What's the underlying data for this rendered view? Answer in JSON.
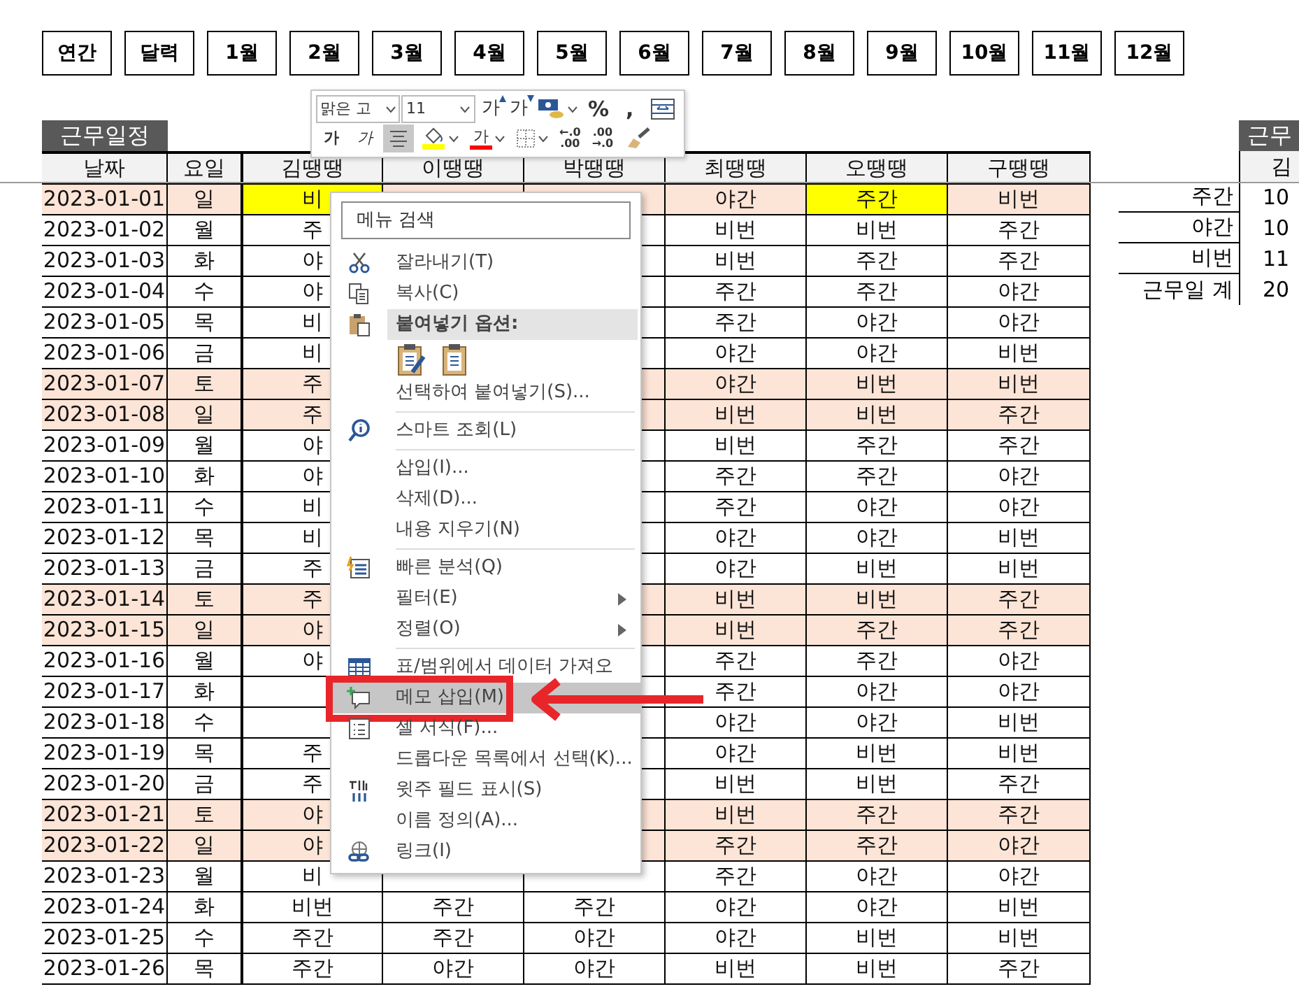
{
  "nav_buttons": [
    "연간",
    "달력",
    "1월",
    "2월",
    "3월",
    "4월",
    "5월",
    "6월",
    "7월",
    "8월",
    "9월",
    "10월",
    "11월",
    "12월"
  ],
  "schedule": {
    "title": "근무일정",
    "columns": [
      "날짜",
      "요일",
      "김땡땡",
      "이땡땡",
      "박땡땡",
      "최땡땡",
      "오땡땡",
      "구땡땡"
    ],
    "rows": [
      {
        "weekend": true,
        "cells": [
          {
            "text": "2023-01-01",
            "highlighted": false
          },
          {
            "text": "일",
            "highlighted": false
          },
          {
            "text": "비",
            "highlighted": true
          },
          null,
          null,
          {
            "text": "야간",
            "highlighted": false
          },
          {
            "text": "주간",
            "highlighted": true
          },
          {
            "text": "비번",
            "highlighted": false
          }
        ]
      },
      {
        "weekend": false,
        "cells": [
          {
            "text": "2023-01-02",
            "highlighted": false
          },
          {
            "text": "월",
            "highlighted": false
          },
          {
            "text": "주",
            "highlighted": false
          },
          null,
          null,
          {
            "text": "비번",
            "highlighted": false
          },
          {
            "text": "비번",
            "highlighted": false
          },
          {
            "text": "주간",
            "highlighted": false
          }
        ]
      },
      {
        "weekend": false,
        "cells": [
          {
            "text": "2023-01-03",
            "highlighted": false
          },
          {
            "text": "화",
            "highlighted": false
          },
          {
            "text": "야",
            "highlighted": false
          },
          null,
          null,
          {
            "text": "비번",
            "highlighted": false
          },
          {
            "text": "주간",
            "highlighted": false
          },
          {
            "text": "주간",
            "highlighted": false
          }
        ]
      },
      {
        "weekend": false,
        "cells": [
          {
            "text": "2023-01-04",
            "highlighted": false
          },
          {
            "text": "수",
            "highlighted": false
          },
          {
            "text": "야",
            "highlighted": false
          },
          null,
          null,
          {
            "text": "주간",
            "highlighted": false
          },
          {
            "text": "주간",
            "highlighted": false
          },
          {
            "text": "야간",
            "highlighted": false
          }
        ]
      },
      {
        "weekend": false,
        "cells": [
          {
            "text": "2023-01-05",
            "highlighted": false
          },
          {
            "text": "목",
            "highlighted": false
          },
          {
            "text": "비",
            "highlighted": false
          },
          null,
          null,
          {
            "text": "주간",
            "highlighted": false
          },
          {
            "text": "야간",
            "highlighted": false
          },
          {
            "text": "야간",
            "highlighted": false
          }
        ]
      },
      {
        "weekend": false,
        "cells": [
          {
            "text": "2023-01-06",
            "highlighted": false
          },
          {
            "text": "금",
            "highlighted": false
          },
          {
            "text": "비",
            "highlighted": false
          },
          null,
          null,
          {
            "text": "야간",
            "highlighted": false
          },
          {
            "text": "야간",
            "highlighted": false
          },
          {
            "text": "비번",
            "highlighted": false
          }
        ]
      },
      {
        "weekend": true,
        "cells": [
          {
            "text": "2023-01-07",
            "highlighted": false
          },
          {
            "text": "토",
            "highlighted": false
          },
          {
            "text": "주",
            "highlighted": false
          },
          null,
          null,
          {
            "text": "야간",
            "highlighted": false
          },
          {
            "text": "비번",
            "highlighted": false
          },
          {
            "text": "비번",
            "highlighted": false
          }
        ]
      },
      {
        "weekend": true,
        "cells": [
          {
            "text": "2023-01-08",
            "highlighted": false
          },
          {
            "text": "일",
            "highlighted": false
          },
          {
            "text": "주",
            "highlighted": false
          },
          null,
          null,
          {
            "text": "비번",
            "highlighted": false
          },
          {
            "text": "비번",
            "highlighted": false
          },
          {
            "text": "주간",
            "highlighted": false
          }
        ]
      },
      {
        "weekend": false,
        "cells": [
          {
            "text": "2023-01-09",
            "highlighted": false
          },
          {
            "text": "월",
            "highlighted": false
          },
          {
            "text": "야",
            "highlighted": false
          },
          null,
          null,
          {
            "text": "비번",
            "highlighted": false
          },
          {
            "text": "주간",
            "highlighted": false
          },
          {
            "text": "주간",
            "highlighted": false
          }
        ]
      },
      {
        "weekend": false,
        "cells": [
          {
            "text": "2023-01-10",
            "highlighted": false
          },
          {
            "text": "화",
            "highlighted": false
          },
          {
            "text": "야",
            "highlighted": false
          },
          null,
          null,
          {
            "text": "주간",
            "highlighted": false
          },
          {
            "text": "주간",
            "highlighted": false
          },
          {
            "text": "야간",
            "highlighted": false
          }
        ]
      },
      {
        "weekend": false,
        "cells": [
          {
            "text": "2023-01-11",
            "highlighted": false
          },
          {
            "text": "수",
            "highlighted": false
          },
          {
            "text": "비",
            "highlighted": false
          },
          null,
          null,
          {
            "text": "주간",
            "highlighted": false
          },
          {
            "text": "야간",
            "highlighted": false
          },
          {
            "text": "야간",
            "highlighted": false
          }
        ]
      },
      {
        "weekend": false,
        "cells": [
          {
            "text": "2023-01-12",
            "highlighted": false
          },
          {
            "text": "목",
            "highlighted": false
          },
          {
            "text": "비",
            "highlighted": false
          },
          null,
          null,
          {
            "text": "야간",
            "highlighted": false
          },
          {
            "text": "야간",
            "highlighted": false
          },
          {
            "text": "비번",
            "highlighted": false
          }
        ]
      },
      {
        "weekend": false,
        "cells": [
          {
            "text": "2023-01-13",
            "highlighted": false
          },
          {
            "text": "금",
            "highlighted": false
          },
          {
            "text": "주",
            "highlighted": false
          },
          null,
          null,
          {
            "text": "야간",
            "highlighted": false
          },
          {
            "text": "비번",
            "highlighted": false
          },
          {
            "text": "비번",
            "highlighted": false
          }
        ]
      },
      {
        "weekend": true,
        "cells": [
          {
            "text": "2023-01-14",
            "highlighted": false
          },
          {
            "text": "토",
            "highlighted": false
          },
          {
            "text": "주",
            "highlighted": false
          },
          null,
          null,
          {
            "text": "비번",
            "highlighted": false
          },
          {
            "text": "비번",
            "highlighted": false
          },
          {
            "text": "주간",
            "highlighted": false
          }
        ]
      },
      {
        "weekend": true,
        "cells": [
          {
            "text": "2023-01-15",
            "highlighted": false
          },
          {
            "text": "일",
            "highlighted": false
          },
          {
            "text": "야",
            "highlighted": false
          },
          null,
          null,
          {
            "text": "비번",
            "highlighted": false
          },
          {
            "text": "주간",
            "highlighted": false
          },
          {
            "text": "주간",
            "highlighted": false
          }
        ]
      },
      {
        "weekend": false,
        "cells": [
          {
            "text": "2023-01-16",
            "highlighted": false
          },
          {
            "text": "월",
            "highlighted": false
          },
          {
            "text": "야",
            "highlighted": false
          },
          null,
          null,
          {
            "text": "주간",
            "highlighted": false
          },
          {
            "text": "주간",
            "highlighted": false
          },
          {
            "text": "야간",
            "highlighted": false
          }
        ]
      },
      {
        "weekend": false,
        "cells": [
          {
            "text": "2023-01-17",
            "highlighted": false
          },
          {
            "text": "화",
            "highlighted": false
          },
          null,
          null,
          null,
          {
            "text": "주간",
            "highlighted": false
          },
          {
            "text": "야간",
            "highlighted": false
          },
          {
            "text": "야간",
            "highlighted": false
          }
        ]
      },
      {
        "weekend": false,
        "cells": [
          {
            "text": "2023-01-18",
            "highlighted": false
          },
          {
            "text": "수",
            "highlighted": false
          },
          null,
          null,
          null,
          {
            "text": "야간",
            "highlighted": false
          },
          {
            "text": "야간",
            "highlighted": false
          },
          {
            "text": "비번",
            "highlighted": false
          }
        ]
      },
      {
        "weekend": false,
        "cells": [
          {
            "text": "2023-01-19",
            "highlighted": false
          },
          {
            "text": "목",
            "highlighted": false
          },
          {
            "text": "주",
            "highlighted": false
          },
          null,
          null,
          {
            "text": "야간",
            "highlighted": false
          },
          {
            "text": "비번",
            "highlighted": false
          },
          {
            "text": "비번",
            "highlighted": false
          }
        ]
      },
      {
        "weekend": false,
        "cells": [
          {
            "text": "2023-01-20",
            "highlighted": false
          },
          {
            "text": "금",
            "highlighted": false
          },
          {
            "text": "주",
            "highlighted": false
          },
          null,
          null,
          {
            "text": "비번",
            "highlighted": false
          },
          {
            "text": "비번",
            "highlighted": false
          },
          {
            "text": "주간",
            "highlighted": false
          }
        ]
      },
      {
        "weekend": true,
        "cells": [
          {
            "text": "2023-01-21",
            "highlighted": false
          },
          {
            "text": "토",
            "highlighted": false
          },
          {
            "text": "야",
            "highlighted": false
          },
          null,
          null,
          {
            "text": "비번",
            "highlighted": false
          },
          {
            "text": "주간",
            "highlighted": false
          },
          {
            "text": "주간",
            "highlighted": false
          }
        ]
      },
      {
        "weekend": true,
        "cells": [
          {
            "text": "2023-01-22",
            "highlighted": false
          },
          {
            "text": "일",
            "highlighted": false
          },
          {
            "text": "야",
            "highlighted": false
          },
          null,
          null,
          {
            "text": "주간",
            "highlighted": false
          },
          {
            "text": "주간",
            "highlighted": false
          },
          {
            "text": "야간",
            "highlighted": false
          }
        ]
      },
      {
        "weekend": false,
        "cells": [
          {
            "text": "2023-01-23",
            "highlighted": false
          },
          {
            "text": "월",
            "highlighted": false
          },
          {
            "text": "비",
            "highlighted": false
          },
          null,
          null,
          {
            "text": "주간",
            "highlighted": false
          },
          {
            "text": "야간",
            "highlighted": false
          },
          {
            "text": "야간",
            "highlighted": false
          }
        ]
      },
      {
        "weekend": false,
        "cells": [
          {
            "text": "2023-01-24",
            "highlighted": false
          },
          {
            "text": "화",
            "highlighted": false
          },
          {
            "text": "비번",
            "highlighted": false
          },
          {
            "text": "주간",
            "highlighted": false
          },
          {
            "text": "주간",
            "highlighted": false
          },
          {
            "text": "야간",
            "highlighted": false
          },
          {
            "text": "야간",
            "highlighted": false
          },
          {
            "text": "비번",
            "highlighted": false
          }
        ]
      },
      {
        "weekend": false,
        "cells": [
          {
            "text": "2023-01-25",
            "highlighted": false
          },
          {
            "text": "수",
            "highlighted": false
          },
          {
            "text": "주간",
            "highlighted": false
          },
          {
            "text": "주간",
            "highlighted": false
          },
          {
            "text": "야간",
            "highlighted": false
          },
          {
            "text": "야간",
            "highlighted": false
          },
          {
            "text": "비번",
            "highlighted": false
          },
          {
            "text": "비번",
            "highlighted": false
          }
        ]
      },
      {
        "weekend": false,
        "cells": [
          {
            "text": "2023-01-26",
            "highlighted": false
          },
          {
            "text": "목",
            "highlighted": false
          },
          {
            "text": "주간",
            "highlighted": false
          },
          {
            "text": "야간",
            "highlighted": false
          },
          {
            "text": "야간",
            "highlighted": false
          },
          {
            "text": "비번",
            "highlighted": false
          },
          {
            "text": "비번",
            "highlighted": false
          },
          {
            "text": "주간",
            "highlighted": false
          }
        ]
      }
    ]
  },
  "summary": {
    "title": "근무",
    "header": "김",
    "rows": [
      {
        "label": "주간",
        "value": "10"
      },
      {
        "label": "야간",
        "value": "10"
      },
      {
        "label": "비번",
        "value": "11"
      },
      {
        "label": "근무일 계",
        "value": "20"
      }
    ]
  },
  "mini_toolbar": {
    "font": "맑은 고",
    "size": "11",
    "row1": [
      {
        "kind": "grow",
        "label": "가"
      },
      {
        "kind": "shrink",
        "label": "가"
      },
      {
        "kind": "accounting"
      },
      {
        "kind": "symbol",
        "label": "%"
      },
      {
        "kind": "symbol",
        "label": ","
      },
      {
        "kind": "wrap"
      }
    ],
    "row2": [
      {
        "kind": "bold",
        "label": "가"
      },
      {
        "kind": "italic",
        "label": "가"
      },
      {
        "kind": "align",
        "on": true
      },
      {
        "kind": "fill"
      },
      {
        "kind": "fontcolor",
        "label": "가"
      },
      {
        "kind": "borders"
      },
      {
        "kind": "decimal",
        "lines": [
          "←.0",
          ".00"
        ]
      },
      {
        "kind": "decimal",
        "lines": [
          ".00",
          "→.0"
        ]
      },
      {
        "kind": "painter"
      }
    ]
  },
  "context_menu": {
    "search": {
      "placeholder": "메뉴 검색"
    },
    "items": [
      {
        "kind": "item",
        "label": "잘라내기(T)",
        "selected": false,
        "submenu": false,
        "callout": false
      },
      {
        "kind": "item",
        "label": "복사(C)",
        "selected": false,
        "submenu": false,
        "callout": false
      },
      {
        "kind": "header",
        "label": "붙여넣기 옵션:"
      },
      {
        "kind": "paste_options"
      },
      {
        "kind": "item",
        "label": "선택하여 붙여넣기(S)...",
        "selected": false,
        "submenu": false,
        "callout": false
      },
      {
        "kind": "separator"
      },
      {
        "kind": "item",
        "label": "스마트 조회(L)",
        "selected": false,
        "submenu": false,
        "callout": false
      },
      {
        "kind": "separator"
      },
      {
        "kind": "item",
        "label": "삽입(I)...",
        "selected": false,
        "submenu": false,
        "callout": false
      },
      {
        "kind": "item",
        "label": "삭제(D)...",
        "selected": false,
        "submenu": false,
        "callout": false
      },
      {
        "kind": "item",
        "label": "내용 지우기(N)",
        "selected": false,
        "submenu": false,
        "callout": false
      },
      {
        "kind": "separator"
      },
      {
        "kind": "item",
        "label": "빠른 분석(Q)",
        "selected": false,
        "submenu": false,
        "callout": false
      },
      {
        "kind": "item",
        "label": "필터(E)",
        "selected": false,
        "submenu": true,
        "callout": false
      },
      {
        "kind": "item",
        "label": "정렬(O)",
        "selected": false,
        "submenu": true,
        "callout": false
      },
      {
        "kind": "separator"
      },
      {
        "kind": "item",
        "label": "표/범위에서 데이터 가져오",
        "selected": false,
        "submenu": false,
        "callout": false
      },
      {
        "kind": "item",
        "label": "메모 삽입(M)",
        "selected": true,
        "submenu": false,
        "callout": true
      },
      {
        "kind": "item",
        "label": "셀 서식(F)...",
        "selected": false,
        "submenu": false,
        "callout": false
      },
      {
        "kind": "item",
        "label": "드롭다운 목록에서 선택(K)...",
        "selected": false,
        "submenu": false,
        "callout": false
      },
      {
        "kind": "item",
        "label": "윗주 필드 표시(S)",
        "selected": false,
        "submenu": false,
        "callout": false
      },
      {
        "kind": "item",
        "label": "이름 정의(A)...",
        "selected": false,
        "submenu": false,
        "callout": false
      },
      {
        "kind": "item",
        "label": "링크(I)",
        "selected": false,
        "submenu": false,
        "callout": false
      }
    ]
  }
}
